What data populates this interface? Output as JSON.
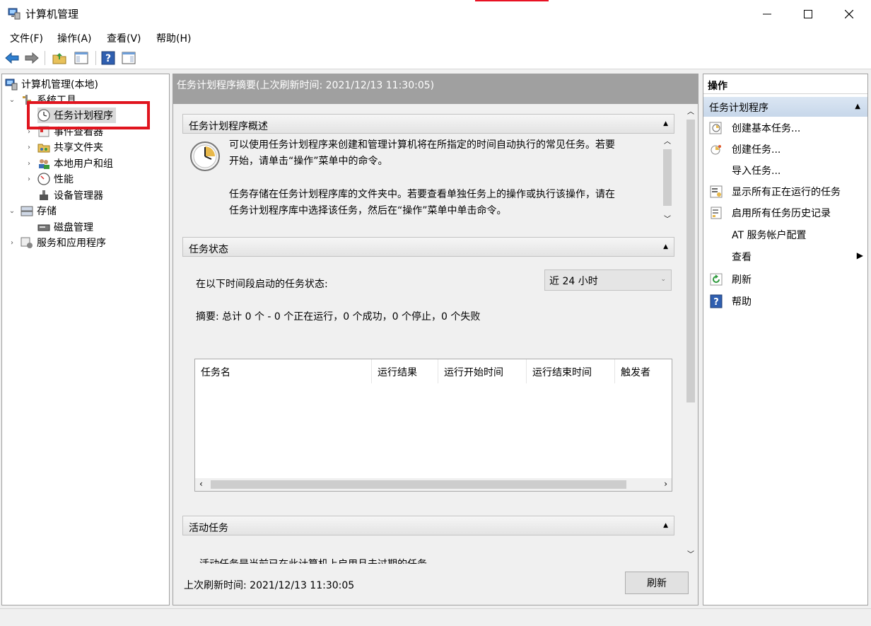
{
  "window": {
    "title": "计算机管理"
  },
  "menu": [
    "文件(F)",
    "操作(A)",
    "查看(V)",
    "帮助(H)"
  ],
  "tree": [
    {
      "label": "计算机管理(本地)"
    },
    {
      "label": "系统工具"
    },
    {
      "label": "任务计划程序"
    },
    {
      "label": "事件查看器"
    },
    {
      "label": "共享文件夹"
    },
    {
      "label": "本地用户和组"
    },
    {
      "label": "性能"
    },
    {
      "label": "设备管理器"
    },
    {
      "label": "存储"
    },
    {
      "label": "磁盘管理"
    },
    {
      "label": "服务和应用程序"
    }
  ],
  "center": {
    "header": "任务计划程序摘要(上次刷新时间: 2021/12/13 11:30:05)",
    "overview": {
      "title": "任务计划程序概述",
      "p1_line1": "可以使用任务计划程序来创建和管理计算机将在所指定的时间自动执行的常见任务。若要",
      "p1_line2": "开始，请单击“操作”菜单中的命令。",
      "p2_line1": "任务存储在任务计划程序库的文件夹中。若要查看单独任务上的操作或执行该操作，请在",
      "p2_line2": "任务计划程序库中选择该任务，然后在“操作”菜单中单击命令。"
    },
    "status": {
      "title": "任务状态",
      "period_label": "在以下时间段启动的任务状态:",
      "period_value": "近 24 小时",
      "summary": "摘要: 总计 0 个 - 0 个正在运行，0 个成功，0 个停止，0 个失败",
      "columns": [
        "任务名",
        "运行结果",
        "运行开始时间",
        "运行结束时间",
        "触发者"
      ]
    },
    "active": {
      "title": "活动任务",
      "text": "活动任务是当前已在此计算机上启用且未过期的任务。"
    },
    "footer": {
      "last_refresh": "上次刷新时间: 2021/12/13 11:30:05",
      "refresh_button": "刷新"
    }
  },
  "actions": {
    "title": "操作",
    "section": "任务计划程序",
    "items": [
      "创建基本任务...",
      "创建任务...",
      "导入任务...",
      "显示所有正在运行的任务",
      "启用所有任务历史记录",
      "AT 服务帐户配置",
      "查看",
      "刷新",
      "帮助"
    ]
  }
}
